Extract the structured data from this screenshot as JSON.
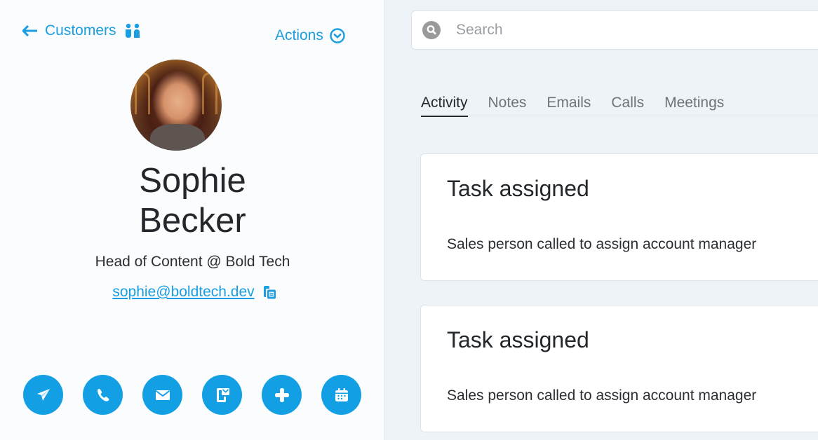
{
  "profile": {
    "back_label": "Customers",
    "actions_label": "Actions",
    "avatar_alt": "Sophie Becker",
    "first_name": "Sophie",
    "last_name": "Becker",
    "title": "Head of Content @ Bold Tech",
    "email": "sophie@boldtech.dev",
    "quick_actions": [
      {
        "name": "send-message",
        "icon": "paper-plane-icon"
      },
      {
        "name": "call",
        "icon": "phone-icon"
      },
      {
        "name": "email",
        "icon": "envelope-icon"
      },
      {
        "name": "mobile-message",
        "icon": "mobile-mail-icon"
      },
      {
        "name": "add",
        "icon": "plus-icon"
      },
      {
        "name": "schedule-meeting",
        "icon": "calendar-icon"
      }
    ]
  },
  "search": {
    "placeholder": "Search",
    "value": ""
  },
  "tabs": [
    {
      "label": "Activity",
      "active": true
    },
    {
      "label": "Notes",
      "active": false
    },
    {
      "label": "Emails",
      "active": false
    },
    {
      "label": "Calls",
      "active": false
    },
    {
      "label": "Meetings",
      "active": false
    }
  ],
  "activities": [
    {
      "title": "Task assigned",
      "description": "Sales person called to assign account manager"
    },
    {
      "title": "Task assigned",
      "description": "Sales person called to assign account manager"
    }
  ],
  "colors": {
    "accent": "#129fe3",
    "link": "#1a9ee0",
    "text": "#23272b",
    "left_bg": "#fafcfe",
    "right_bg": "#eef3f7"
  }
}
